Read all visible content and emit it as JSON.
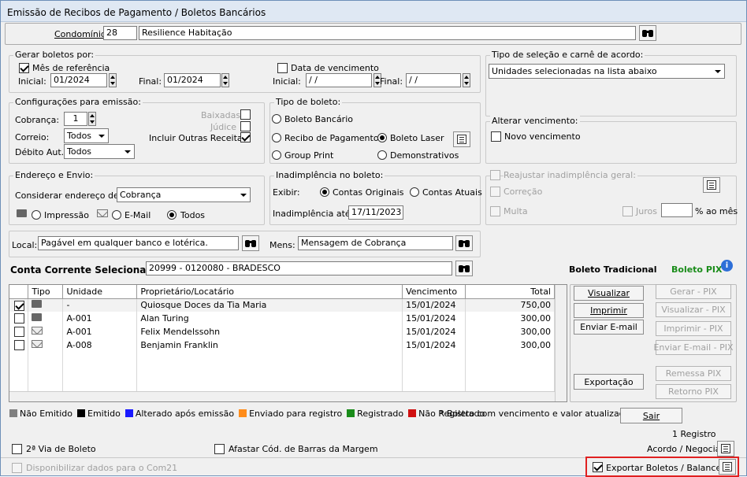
{
  "window": {
    "title": "Emissão de Recibos de Pagamento / Boletos Bancários"
  },
  "condominio": {
    "label": "Condomínio:",
    "code": "28",
    "name": "Resilience Habitação"
  },
  "gerar": {
    "title": "Gerar boletos por:",
    "mes_label": "Mês de referência",
    "inicial_label": "Inicial:",
    "inicial": "01/2024",
    "final_label": "Final:",
    "final": "01/2024",
    "venc_label": "Data de vencimento",
    "venc_inicial": " / /",
    "venc_final": " / /"
  },
  "tipo_selecao": {
    "title": "Tipo de seleção e carnê de acordo:",
    "value": "Unidades selecionadas na lista abaixo"
  },
  "config": {
    "title": "Configurações para emissão:",
    "cobranca_label": "Cobrança:",
    "cobranca": "1",
    "correio_label": "Correio:",
    "correio": "Todos",
    "debito_label": "Débito Aut.:",
    "debito": "Todos",
    "baixadas": "Baixadas",
    "judice": "Júdice",
    "outras": "Incluir Outras Receitas"
  },
  "tipo_boleto": {
    "title": "Tipo de boleto:",
    "bancario": "Boleto Bancário",
    "recibo": "Recibo de Pagamento",
    "laser": "Boleto Laser",
    "group": "Group Print",
    "demonstrativos": "Demonstrativos"
  },
  "alterar": {
    "title": "Alterar vencimento:",
    "novo": "Novo vencimento"
  },
  "endereco": {
    "title": "Endereço e Envio:",
    "considerar_label": "Considerar endereço de:",
    "considerar": "Cobrança",
    "impressao": "Impressão",
    "email": "E-Mail",
    "todos": "Todos"
  },
  "inadimplencia": {
    "title": "Inadimplência no boleto:",
    "exibir_label": "Exibir:",
    "contas_originais": "Contas Originais",
    "contas_atuais": "Contas Atuais",
    "ate_label": "Inadimplência até:",
    "ate": "17/11/2023"
  },
  "reajustar": {
    "label": "Reajustar inadimplência geral:",
    "correcao": "Correção",
    "multa": "Multa",
    "juros": "Juros",
    "juros_value": "",
    "unit": "% ao mês"
  },
  "local": {
    "label": "Local:",
    "value": "Pagável em qualquer banco e lotérica.",
    "mens_label": "Mens:",
    "mens": "Mensagem de Cobrança"
  },
  "conta": {
    "label": "Conta Corrente Selecionada:",
    "value": "20999 - 0120080 - BRADESCO"
  },
  "boleto_trad": "Boleto Tradicional",
  "boleto_pix": "Boleto PIX",
  "table": {
    "headers": [
      "Tipo",
      "Unidade",
      "Proprietário/Locatário",
      "Vencimento",
      "Total"
    ],
    "rows": [
      {
        "checked": true,
        "tipo": "printer",
        "unidade": "-",
        "nome": "Quiosque Doces da Tia Maria",
        "venc": "15/01/2024",
        "total": "750,00"
      },
      {
        "checked": false,
        "tipo": "printer",
        "unidade": "A-001",
        "nome": "Alan Turing",
        "venc": "15/01/2024",
        "total": "300,00"
      },
      {
        "checked": false,
        "tipo": "email",
        "unidade": "A-001",
        "nome": "Felix Mendelssohn",
        "venc": "15/01/2024",
        "total": "300,00"
      },
      {
        "checked": false,
        "tipo": "email",
        "unidade": "A-008",
        "nome": "Benjamin Franklin",
        "venc": "15/01/2024",
        "total": "300,00"
      }
    ]
  },
  "buttons": {
    "visualizar": "Visualizar",
    "imprimir": "Imprimir",
    "enviar": "Enviar E-mail",
    "exportacao": "Exportação",
    "gerar_pix": "Gerar - PIX",
    "visualizar_pix": "Visualizar - PIX",
    "imprimir_pix": "Imprimir - PIX",
    "enviar_pix": "Enviar E-mail - PIX",
    "remessa_pix": "Remessa PIX",
    "retorno_pix": "Retorno PIX",
    "sair": "Sair"
  },
  "legend": [
    {
      "color": "#808080",
      "label": "Não Emitido"
    },
    {
      "color": "#000000",
      "label": "Emitido"
    },
    {
      "color": "#1a1aff",
      "label": "Alterado após emissão"
    },
    {
      "color": "#ff8c1a",
      "label": "Enviado para registro"
    },
    {
      "color": "#1a8c1a",
      "label": "Registrado"
    },
    {
      "color": "#d01010",
      "label": "Não Registrado"
    }
  ],
  "legend_note": "* Boleto com vencimento e valor atualizados.",
  "registros": "1 Registro",
  "footer": {
    "segunda_via": "2ª Via de Boleto",
    "afastar": "Afastar Cód. de Barras da Margem",
    "acordo": "Acordo / Negociar",
    "disponibilizar": "Disponibilizar dados para o Com21",
    "exportar": "Exportar Boletos / Balancete"
  }
}
